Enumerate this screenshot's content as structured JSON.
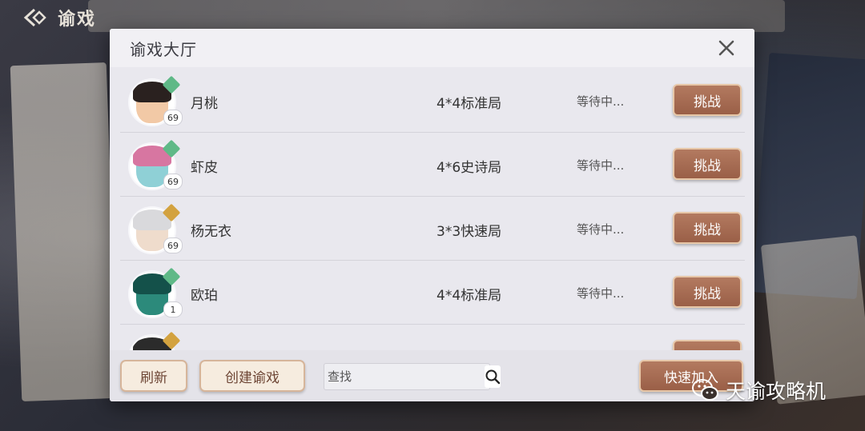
{
  "game": {
    "title": "谕戏"
  },
  "modal": {
    "title": "谕戏大厅"
  },
  "rooms": [
    {
      "name": "月桃",
      "level": "69",
      "mode": "4*4标准局",
      "status": "等待中...",
      "action": "挑战",
      "avatar_color": "#f2c9a6",
      "hair_color": "#2a211f",
      "badge_color": "#5fb987"
    },
    {
      "name": "虾皮",
      "level": "69",
      "mode": "4*6史诗局",
      "status": "等待中...",
      "action": "挑战",
      "avatar_color": "#8fd0d6",
      "hair_color": "#d776a1",
      "badge_color": "#5fb987"
    },
    {
      "name": "杨无衣",
      "level": "69",
      "mode": "3*3快速局",
      "status": "等待中...",
      "action": "挑战",
      "avatar_color": "#efdccc",
      "hair_color": "#d9d9dc",
      "badge_color": "#d3a23f"
    },
    {
      "name": "欧珀",
      "level": "1",
      "mode": "4*4标准局",
      "status": "等待中...",
      "action": "挑战",
      "avatar_color": "#2c8a7b",
      "hair_color": "#14514a",
      "badge_color": "#5fb987"
    },
    {
      "name": "",
      "level": "",
      "mode": "",
      "status": "",
      "action": "",
      "avatar_color": "#e8d9cb",
      "hair_color": "#2b2b2b",
      "badge_color": "#d3a23f"
    }
  ],
  "bottom": {
    "refresh_label": "刷新",
    "create_label": "创建谕戏",
    "search_placeholder": "查找",
    "quick_join_label": "快速加入"
  },
  "watermark": {
    "text": "天谕攻略机"
  },
  "colors": {
    "accent": "#a86a50",
    "button_border": "#e7c7a8",
    "panel": "#e9e8ee"
  }
}
